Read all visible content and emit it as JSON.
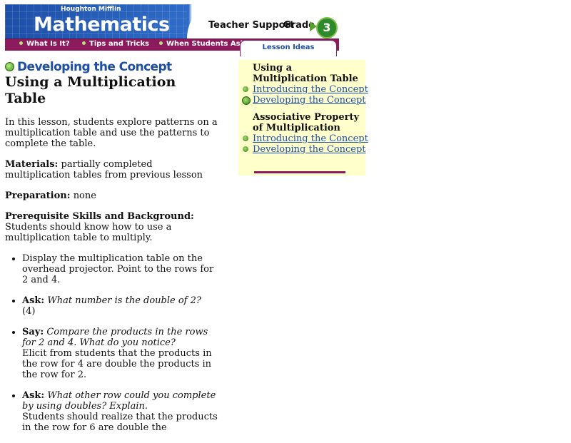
{
  "header": {
    "publisher": "Houghton Mifflin",
    "brand": "Mathematics",
    "teacher_support": "Teacher Support",
    "grade_label": "Grade",
    "grade_value": "3"
  },
  "nav": {
    "items": [
      "What Is It?",
      "Tips and Tricks",
      "When Students Ask"
    ],
    "active_tab": "Lesson Ideas"
  },
  "main": {
    "section_heading": "Developing the Concept",
    "title": "Using a Multiplication Table",
    "intro": "In this lesson, students explore patterns on a multiplication table and use the patterns to complete the table.",
    "materials_label": "Materials:",
    "materials_text": "partially completed multiplication tables from previous lesson",
    "preparation_label": "Preparation:",
    "preparation_text": "none",
    "prereq_label": "Prerequisite Skills and Background:",
    "prereq_text": "Students should know how to use a multiplication table to multiply.",
    "steps": [
      {
        "plain": "Display the multiplication table on the overhead projector. Point to the rows for 2 and 4."
      },
      {
        "label": "Ask:",
        "italic": "What number is the double of 2?",
        "plain": "(4)"
      },
      {
        "label": "Say:",
        "italic": "Compare the products in the rows for 2 and 4. What do you notice?",
        "plain": "Elicit from students that the products in the row for 4 are double the products in the row for 2."
      },
      {
        "label": "Ask:",
        "italic": "What other row could you complete by using doubles? Explain.",
        "plain": "Students should realize that the products in the row for 6 are double the"
      }
    ]
  },
  "side": {
    "group1_title_line1": "Using a",
    "group1_title_line2": "Multiplication Table",
    "group1_links": [
      "Introducing the Concept",
      "Developing the Concept"
    ],
    "group2_title_line1": "Associative Property",
    "group2_title_line2": "of Multiplication",
    "group2_links": [
      "Introducing the Concept",
      "Developing the Concept"
    ]
  },
  "colors": {
    "brand_blue": "#1d4fa8",
    "nav_maroon": "#8c1a5c",
    "side_panel": "#ffffcc",
    "bullet_green": "#3b8f22"
  }
}
